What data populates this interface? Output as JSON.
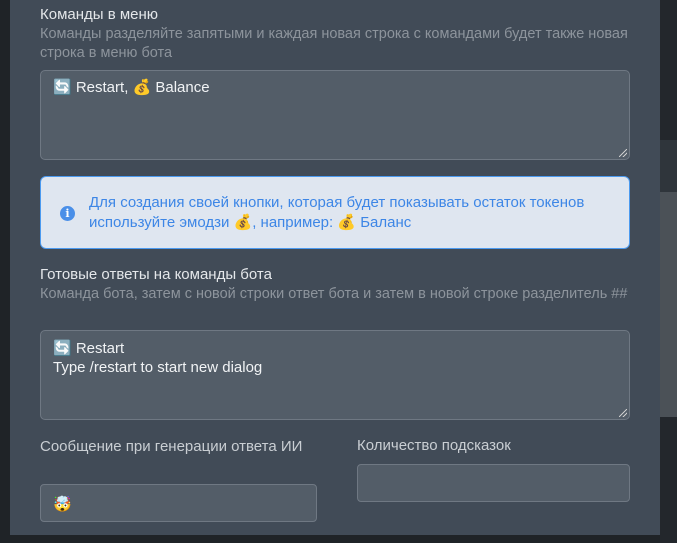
{
  "menu_commands": {
    "label": "Команды в меню",
    "hint": "Команды разделяйте запятыми и каждая новая строка с командами будет также новая строка в меню бота",
    "value": "🔄 Restart, 💰 Balance"
  },
  "info": {
    "text": "Для создания своей кнопки, которая будет показывать остаток токенов используйте эмодзи 💰, например: 💰 Баланс",
    "icon": "info-icon",
    "color": "#3d86e6"
  },
  "ready_answers": {
    "label": "Готовые ответы на команды бота",
    "hint": "Команда бота, затем с новой строки ответ бота и затем в новой строке разделитель ##",
    "value": "🔄 Restart\nType /restart to start new dialog"
  },
  "generation_message": {
    "label": "Сообщение при генерации ответа ИИ",
    "value": "🤯"
  },
  "hints_count": {
    "label": "Количество подсказок",
    "value": ""
  }
}
